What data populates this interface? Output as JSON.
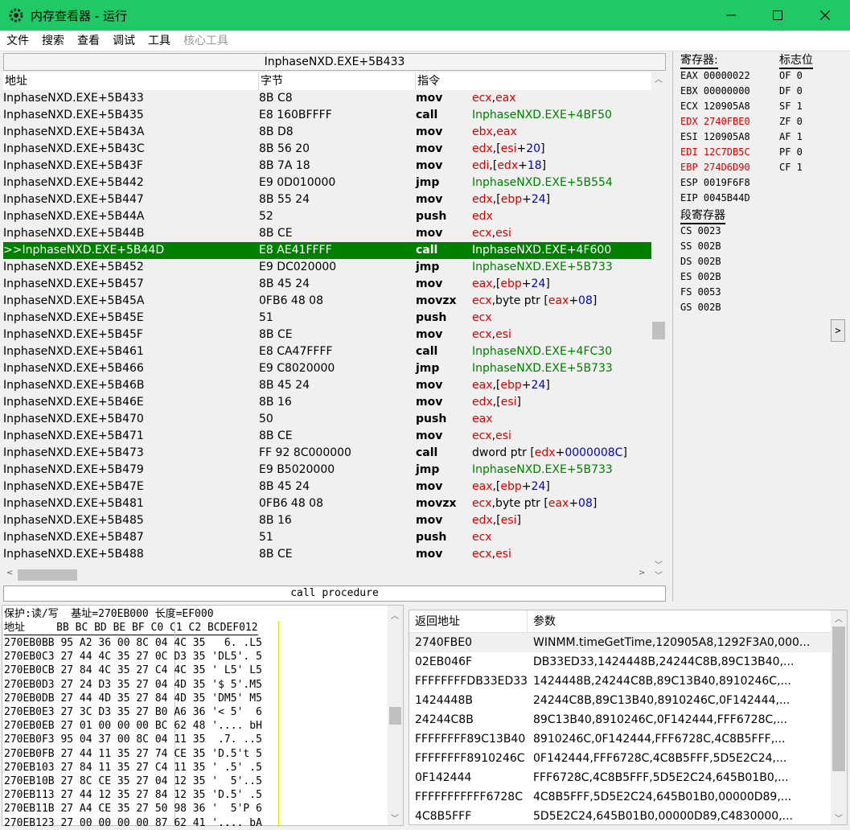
{
  "window": {
    "title": "内存查看器 - 运行",
    "min": "—",
    "max": "☐",
    "close": "✕"
  },
  "menu": [
    "文件",
    "搜索",
    "查看",
    "调试",
    "工具",
    "核心工具"
  ],
  "disasm": {
    "header": "InphaseNXD.EXE+5B433",
    "columns": [
      "地址",
      "字节",
      "指令"
    ],
    "rows": [
      {
        "addr": "InphaseNXD.EXE+5B433",
        "bytes": "8B C8",
        "op": "mov",
        "args": [
          [
            "r",
            "ecx"
          ],
          [
            "k",
            ","
          ],
          [
            "r",
            "eax"
          ]
        ]
      },
      {
        "addr": "InphaseNXD.EXE+5B435",
        "bytes": "E8 160BFFFF",
        "op": "call",
        "args": [
          [
            "g",
            "InphaseNXD.EXE+4BF50"
          ]
        ]
      },
      {
        "addr": "InphaseNXD.EXE+5B43A",
        "bytes": "8B D8",
        "op": "mov",
        "args": [
          [
            "r",
            "ebx"
          ],
          [
            "k",
            ","
          ],
          [
            "r",
            "eax"
          ]
        ]
      },
      {
        "addr": "InphaseNXD.EXE+5B43C",
        "bytes": "8B 56 20",
        "op": "mov",
        "args": [
          [
            "r",
            "edx"
          ],
          [
            "k",
            ",["
          ],
          [
            "r",
            "esi"
          ],
          [
            "k",
            "+"
          ],
          [
            "b",
            "20"
          ],
          [
            "k",
            "]"
          ]
        ]
      },
      {
        "addr": "InphaseNXD.EXE+5B43F",
        "bytes": "8B 7A 18",
        "op": "mov",
        "args": [
          [
            "r",
            "edi"
          ],
          [
            "k",
            ",["
          ],
          [
            "r",
            "edx"
          ],
          [
            "k",
            "+"
          ],
          [
            "b",
            "18"
          ],
          [
            "k",
            "]"
          ]
        ]
      },
      {
        "addr": "InphaseNXD.EXE+5B442",
        "bytes": "E9 0D010000",
        "op": "jmp",
        "args": [
          [
            "g",
            "InphaseNXD.EXE+5B554"
          ]
        ]
      },
      {
        "addr": "InphaseNXD.EXE+5B447",
        "bytes": "8B 55 24",
        "op": "mov",
        "args": [
          [
            "r",
            "edx"
          ],
          [
            "k",
            ",["
          ],
          [
            "r",
            "ebp"
          ],
          [
            "k",
            "+"
          ],
          [
            "b",
            "24"
          ],
          [
            "k",
            "]"
          ]
        ]
      },
      {
        "addr": "InphaseNXD.EXE+5B44A",
        "bytes": "52",
        "op": "push",
        "args": [
          [
            "r",
            "edx"
          ]
        ]
      },
      {
        "addr": "InphaseNXD.EXE+5B44B",
        "bytes": "8B CE",
        "op": "mov",
        "args": [
          [
            "r",
            "ecx"
          ],
          [
            "k",
            ","
          ],
          [
            "r",
            "esi"
          ]
        ]
      },
      {
        "addr": ">>InphaseNXD.EXE+5B44D",
        "bytes": "E8 AE41FFFF",
        "op": "call",
        "args": [
          [
            "g",
            "InphaseNXD.EXE+4F600"
          ]
        ],
        "selected": true
      },
      {
        "addr": "InphaseNXD.EXE+5B452",
        "bytes": "E9 DC020000",
        "op": "jmp",
        "args": [
          [
            "g",
            "InphaseNXD.EXE+5B733"
          ]
        ]
      },
      {
        "addr": "InphaseNXD.EXE+5B457",
        "bytes": "8B 45 24",
        "op": "mov",
        "args": [
          [
            "r",
            "eax"
          ],
          [
            "k",
            ",["
          ],
          [
            "r",
            "ebp"
          ],
          [
            "k",
            "+"
          ],
          [
            "b",
            "24"
          ],
          [
            "k",
            "]"
          ]
        ]
      },
      {
        "addr": "InphaseNXD.EXE+5B45A",
        "bytes": "0FB6 48 08",
        "op": "movzx",
        "args": [
          [
            "r",
            "ecx"
          ],
          [
            "k",
            ",byte ptr ["
          ],
          [
            "r",
            "eax"
          ],
          [
            "k",
            "+"
          ],
          [
            "b",
            "08"
          ],
          [
            "k",
            "]"
          ]
        ]
      },
      {
        "addr": "InphaseNXD.EXE+5B45E",
        "bytes": "51",
        "op": "push",
        "args": [
          [
            "r",
            "ecx"
          ]
        ]
      },
      {
        "addr": "InphaseNXD.EXE+5B45F",
        "bytes": "8B CE",
        "op": "mov",
        "args": [
          [
            "r",
            "ecx"
          ],
          [
            "k",
            ","
          ],
          [
            "r",
            "esi"
          ]
        ]
      },
      {
        "addr": "InphaseNXD.EXE+5B461",
        "bytes": "E8 CA47FFFF",
        "op": "call",
        "args": [
          [
            "g",
            "InphaseNXD.EXE+4FC30"
          ]
        ]
      },
      {
        "addr": "InphaseNXD.EXE+5B466",
        "bytes": "E9 C8020000",
        "op": "jmp",
        "args": [
          [
            "g",
            "InphaseNXD.EXE+5B733"
          ]
        ]
      },
      {
        "addr": "InphaseNXD.EXE+5B46B",
        "bytes": "8B 45 24",
        "op": "mov",
        "args": [
          [
            "r",
            "eax"
          ],
          [
            "k",
            ",["
          ],
          [
            "r",
            "ebp"
          ],
          [
            "k",
            "+"
          ],
          [
            "b",
            "24"
          ],
          [
            "k",
            "]"
          ]
        ]
      },
      {
        "addr": "InphaseNXD.EXE+5B46E",
        "bytes": "8B 16",
        "op": "mov",
        "args": [
          [
            "r",
            "edx"
          ],
          [
            "k",
            ",["
          ],
          [
            "r",
            "esi"
          ],
          [
            "k",
            "]"
          ]
        ]
      },
      {
        "addr": "InphaseNXD.EXE+5B470",
        "bytes": "50",
        "op": "push",
        "args": [
          [
            "r",
            "eax"
          ]
        ]
      },
      {
        "addr": "InphaseNXD.EXE+5B471",
        "bytes": "8B CE",
        "op": "mov",
        "args": [
          [
            "r",
            "ecx"
          ],
          [
            "k",
            ","
          ],
          [
            "r",
            "esi"
          ]
        ]
      },
      {
        "addr": "InphaseNXD.EXE+5B473",
        "bytes": "FF 92 8C000000",
        "op": "call",
        "args": [
          [
            "k",
            "dword ptr ["
          ],
          [
            "r",
            "edx"
          ],
          [
            "k",
            "+"
          ],
          [
            "b",
            "0000008C"
          ],
          [
            "k",
            "]"
          ]
        ]
      },
      {
        "addr": "InphaseNXD.EXE+5B479",
        "bytes": "E9 B5020000",
        "op": "jmp",
        "args": [
          [
            "g",
            "InphaseNXD.EXE+5B733"
          ]
        ]
      },
      {
        "addr": "InphaseNXD.EXE+5B47E",
        "bytes": "8B 45 24",
        "op": "mov",
        "args": [
          [
            "r",
            "eax"
          ],
          [
            "k",
            ",["
          ],
          [
            "r",
            "ebp"
          ],
          [
            "k",
            "+"
          ],
          [
            "b",
            "24"
          ],
          [
            "k",
            "]"
          ]
        ]
      },
      {
        "addr": "InphaseNXD.EXE+5B481",
        "bytes": "0FB6 48 08",
        "op": "movzx",
        "args": [
          [
            "r",
            "ecx"
          ],
          [
            "k",
            ",byte ptr ["
          ],
          [
            "r",
            "eax"
          ],
          [
            "k",
            "+"
          ],
          [
            "b",
            "08"
          ],
          [
            "k",
            "]"
          ]
        ]
      },
      {
        "addr": "InphaseNXD.EXE+5B485",
        "bytes": "8B 16",
        "op": "mov",
        "args": [
          [
            "r",
            "edx"
          ],
          [
            "k",
            ",["
          ],
          [
            "r",
            "esi"
          ],
          [
            "k",
            "]"
          ]
        ]
      },
      {
        "addr": "InphaseNXD.EXE+5B487",
        "bytes": "51",
        "op": "push",
        "args": [
          [
            "r",
            "ecx"
          ]
        ]
      },
      {
        "addr": "InphaseNXD.EXE+5B488",
        "bytes": "8B CE",
        "op": "mov",
        "args": [
          [
            "r",
            "ecx"
          ],
          [
            "k",
            ","
          ],
          [
            "r",
            "esi"
          ]
        ]
      }
    ],
    "status": "call procedure"
  },
  "registers": {
    "title": "寄存器:",
    "flags_title": "标志位",
    "regs": [
      {
        "text": "EAX 00000022",
        "changed": false
      },
      {
        "text": "EBX 00000000",
        "changed": false
      },
      {
        "text": "ECX 120905A8",
        "changed": false
      },
      {
        "text": "EDX 2740FBE0",
        "changed": true
      },
      {
        "text": "ESI 120905A8",
        "changed": false
      },
      {
        "text": "EDI 12C7DB5C",
        "changed": true
      },
      {
        "text": "EBP 274D6D90",
        "changed": true
      },
      {
        "text": "ESP 0019F6F8",
        "changed": false
      },
      {
        "text": "EIP 0045B44D",
        "changed": false
      }
    ],
    "flags": [
      "OF 0",
      "DF 0",
      "SF 1",
      "ZF 0",
      "AF 1",
      "PF 0",
      "CF 1"
    ],
    "seg_title": "段寄存器",
    "segs": [
      "CS 0023",
      "SS 002B",
      "DS 002B",
      "ES 002B",
      "FS 0053",
      "GS 002B"
    ],
    "expand": ">"
  },
  "hex": {
    "info": "保护:读/写  基址=270EB000 长度=EF000",
    "header": "地址     BB BC BD BE BF C0 C1 C2 BCDEF012",
    "rows": [
      "270EB0BB 95 A2 36 00 8C 04 4C 35   6. .L5",
      "270EB0C3 27 44 4C 35 27 0C D3 35 'DL5'. 5",
      "270EB0CB 27 84 4C 35 27 C4 4C 35 ' L5' L5",
      "270EB0D3 27 24 D3 35 27 04 4D 35 '$ 5'.M5",
      "270EB0DB 27 44 4D 35 27 84 4D 35 'DM5' M5",
      "270EB0E3 27 3C D3 35 27 B0 A6 36 '< 5'  6",
      "270EB0EB 27 01 00 00 00 BC 62 48 '.... bH",
      "270EB0F3 95 04 37 00 8C 04 11 35  .7. ..5",
      "270EB0FB 27 44 11 35 27 74 CE 35 'D.5't 5",
      "270EB103 27 84 11 35 27 C4 11 35 ' .5' .5",
      "270EB10B 27 8C CE 35 27 04 12 35 '  5'..5",
      "270EB113 27 44 12 35 27 84 12 35 'D.5' .5",
      "270EB11B 27 A4 CE 35 27 50 98 36 '  5'P 6",
      "270EB123 27 00 00 00 00 87 62 41 '.... bA"
    ]
  },
  "stack": {
    "columns": [
      "返回地址",
      "参数"
    ],
    "rows": [
      {
        "ret": "2740FBE0",
        "params": "WINMM.timeGetTime,120905A8,1292F3A0,000..."
      },
      {
        "ret": "02EB046F",
        "params": "DB33ED33,1424448B,24244C8B,89C13B40,..."
      },
      {
        "ret": "FFFFFFFFDB33ED33",
        "params": "1424448B,24244C8B,89C13B40,8910246C,..."
      },
      {
        "ret": "1424448B",
        "params": "24244C8B,89C13B40,8910246C,0F142444,..."
      },
      {
        "ret": "24244C8B",
        "params": "89C13B40,8910246C,0F142444,FFF6728C,..."
      },
      {
        "ret": "FFFFFFFF89C13B40",
        "params": "8910246C,0F142444,FFF6728C,4C8B5FFF,..."
      },
      {
        "ret": "FFFFFFFF8910246C",
        "params": "0F142444,FFF6728C,4C8B5FFF,5D5E2C24,..."
      },
      {
        "ret": "0F142444",
        "params": "FFF6728C,4C8B5FFF,5D5E2C24,645B01B0,..."
      },
      {
        "ret": "FFFFFFFFFFF6728C",
        "params": "4C8B5FFF,5D5E2C24,645B01B0,00000D89,..."
      },
      {
        "ret": "4C8B5FFF",
        "params": "5D5E2C24,645B01B0,00000D89,C4830000,..."
      }
    ]
  },
  "colors": {
    "titlebar": "#1fc965",
    "selected_row": "#008000",
    "register_changed": "#e00000",
    "jump_target": "#008000",
    "immediate": "#0000d0"
  }
}
